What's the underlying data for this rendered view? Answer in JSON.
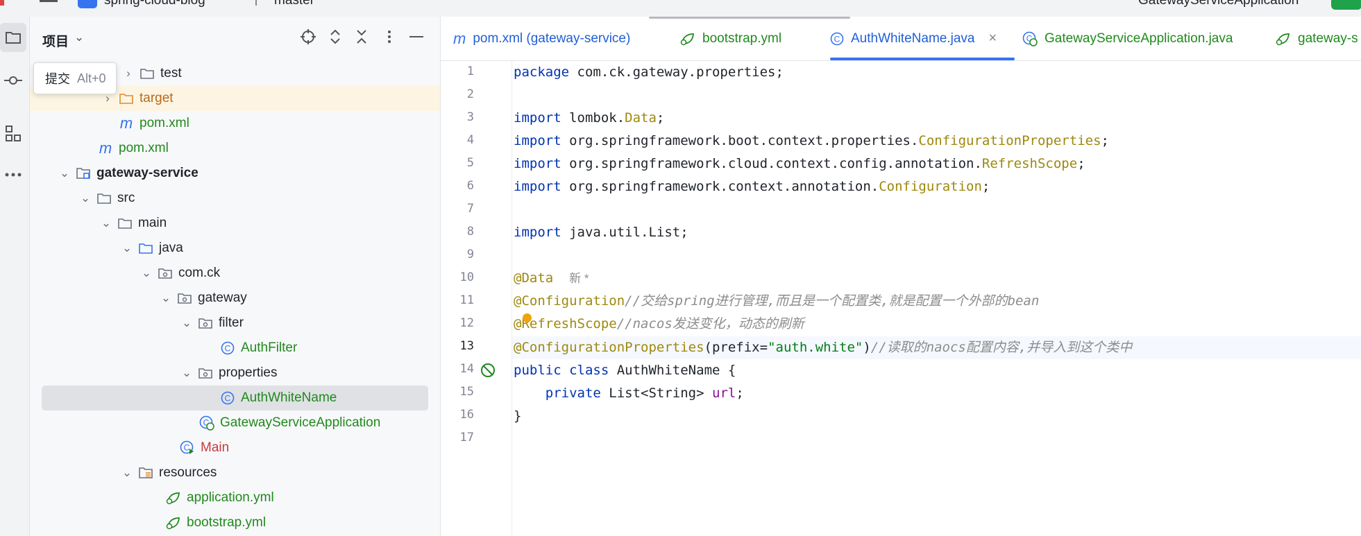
{
  "titlebar": {
    "project_name": "spring-cloud-blog",
    "branch": "master",
    "run_config": "GatewayServiceApplication"
  },
  "activity_bar": {
    "items": [
      "folder-icon",
      "commit-icon",
      "structure-icon",
      "more-icon"
    ]
  },
  "tooltip": {
    "label": "提交",
    "shortcut": "Alt+0"
  },
  "project_panel": {
    "title": "项目",
    "tree": [
      {
        "label": "test",
        "kind": "folder",
        "depth": 5
      },
      {
        "label": "target",
        "kind": "folder-excluded",
        "depth": 4
      },
      {
        "label": "pom.xml",
        "kind": "maven",
        "depth": 4
      },
      {
        "label": "pom.xml",
        "kind": "maven",
        "depth": 3
      },
      {
        "label": "gateway-service",
        "kind": "module",
        "depth": 2
      },
      {
        "label": "src",
        "kind": "folder",
        "depth": 3
      },
      {
        "label": "main",
        "kind": "folder",
        "depth": 4
      },
      {
        "label": "java",
        "kind": "source-folder",
        "depth": 5
      },
      {
        "label": "com.ck",
        "kind": "package",
        "depth": 6
      },
      {
        "label": "gateway",
        "kind": "package",
        "depth": 7
      },
      {
        "label": "filter",
        "kind": "package",
        "depth": 8
      },
      {
        "label": "AuthFilter",
        "kind": "class",
        "depth": 9
      },
      {
        "label": "properties",
        "kind": "package",
        "depth": 8
      },
      {
        "label": "AuthWhiteName",
        "kind": "class",
        "depth": 9
      },
      {
        "label": "GatewayServiceApplication",
        "kind": "spring-class",
        "depth": 8
      },
      {
        "label": "Main",
        "kind": "main-class",
        "depth": 7
      },
      {
        "label": "resources",
        "kind": "resources-folder",
        "depth": 5
      },
      {
        "label": "application.yml",
        "kind": "yml",
        "depth": 6
      },
      {
        "label": "bootstrap.yml",
        "kind": "yml",
        "depth": 6
      }
    ]
  },
  "tabs": [
    {
      "label": "pom.xml (gateway-service)",
      "icon": "maven-icon"
    },
    {
      "label": "bootstrap.yml",
      "icon": "spring-yml-icon"
    },
    {
      "label": "AuthWhiteName.java",
      "icon": "class-icon",
      "active": true
    },
    {
      "label": "GatewayServiceApplication.java",
      "icon": "spring-class-icon"
    },
    {
      "label": "gateway-s",
      "icon": "spring-yml-icon"
    }
  ],
  "editor": {
    "line_numbers": [
      "1",
      "2",
      "3",
      "4",
      "5",
      "6",
      "7",
      "8",
      "9",
      "10",
      "11",
      "12",
      "13",
      "14",
      "15",
      "16",
      "17"
    ],
    "current_line": 13,
    "lines": {
      "l1": {
        "kw": "package",
        "rest": " com.ck.gateway.properties;"
      },
      "l3": {
        "kw": "import",
        "rest": " lombok.",
        "ann": "Data",
        "end": ";"
      },
      "l4": {
        "kw": "import",
        "rest": " org.springframework.boot.context.properties.",
        "ann": "ConfigurationProperties",
        "end": ";"
      },
      "l5": {
        "kw": "import",
        "rest": " org.springframework.cloud.context.config.annotation.",
        "ann": "RefreshScope",
        "end": ";"
      },
      "l6": {
        "kw": "import",
        "rest": " org.springframework.context.annotation.",
        "ann": "Configuration",
        "end": ";"
      },
      "l8": {
        "kw": "import",
        "rest": " java.util.List;"
      },
      "l10": {
        "ann": "@Data",
        "newtag": "新 *"
      },
      "l11": {
        "ann": "@Configuration",
        "cmt": "//交给spring进行管理,而且是一个配置类,就是配置一个外部的bean"
      },
      "l12": {
        "ann": "@RefreshScope",
        "cmt": "//nacos发送变化，动态的刷新"
      },
      "l13": {
        "ann": "@ConfigurationProperties",
        "p1": "(prefix=",
        "str": "\"auth.white\"",
        "p2": ")",
        "cmt": "//读取的naocs配置内容,并导入到这个类中"
      },
      "l14": {
        "kw1": "public",
        "kw2": "class",
        "rest": " AuthWhiteName {"
      },
      "l15": {
        "indent": "    ",
        "kw": "private",
        "rest": " List<String> ",
        "fld": "url",
        "end": ";"
      },
      "l16": {
        "rest": "}"
      }
    }
  }
}
